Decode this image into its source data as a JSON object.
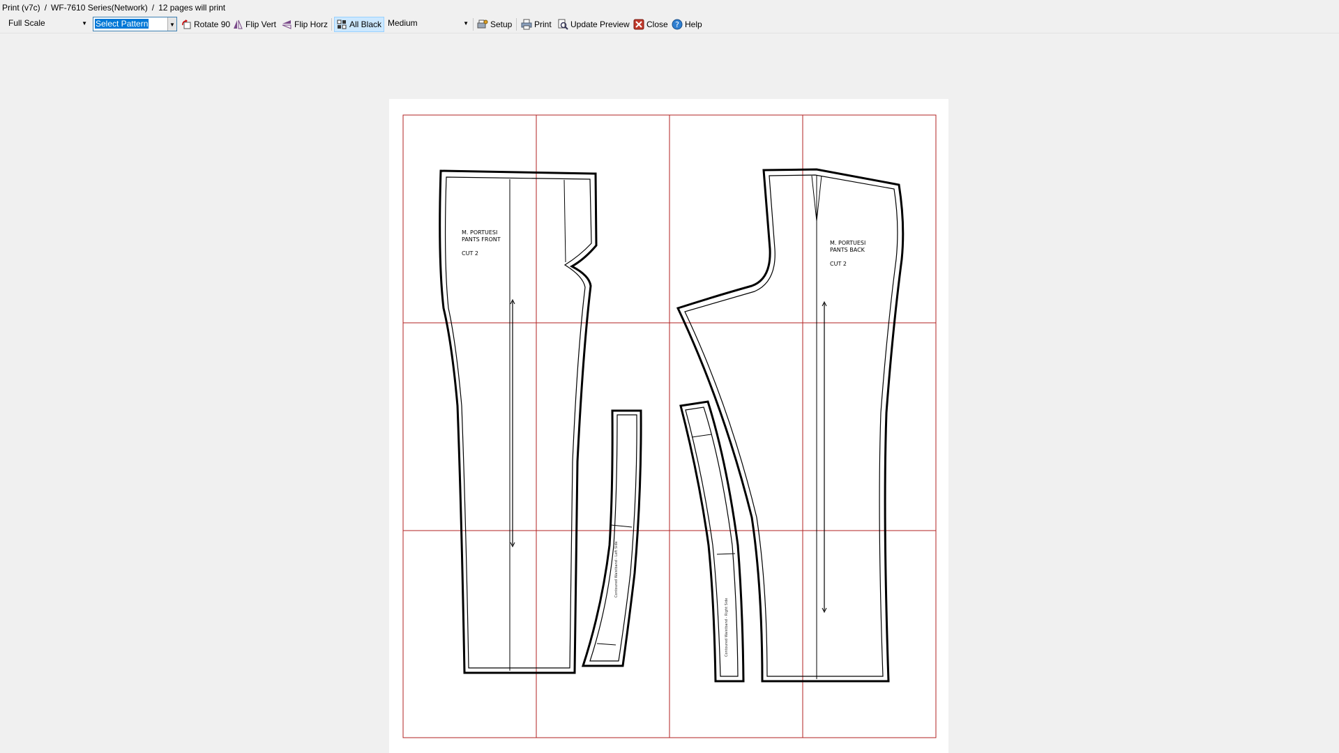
{
  "titlebar": {
    "app": "Print (v7c)",
    "sep": "/",
    "printer": "WF-7610 Series(Network)",
    "pages": "12 pages will print"
  },
  "toolbar": {
    "scale": "Full Scale",
    "pattern": "Select Pattern",
    "rotate": "Rotate 90",
    "flip_vert": "Flip Vert",
    "flip_horz": "Flip Horz",
    "all_black": "All Black",
    "thickness": "Medium",
    "setup": "Setup",
    "print": "Print",
    "update_preview": "Update Preview",
    "close": "Close",
    "help": "Help"
  },
  "pattern": {
    "front": {
      "name": "M. PORTUESI",
      "piece": "PANTS FRONT",
      "cut": "CUT 2"
    },
    "back": {
      "name": "M. PORTUESI",
      "piece": "PANTS BACK",
      "cut": "CUT 2"
    },
    "waistband_left": "Contoured Waistband - Left Side",
    "waistband_right": "Contoured Waistband - Right Side"
  },
  "colors": {
    "page_grid": "#b22222",
    "selection": "#0078d7",
    "toolbar_active": "#cce8ff"
  },
  "icons": {
    "rotate": "rotate-icon",
    "flip_vert": "flip-vert-icon",
    "flip_horz": "flip-horz-icon",
    "all_black": "all-black-icon",
    "setup": "setup-icon",
    "print": "printer-icon",
    "update_preview": "update-preview-icon",
    "close": "close-icon",
    "help": "help-icon"
  }
}
